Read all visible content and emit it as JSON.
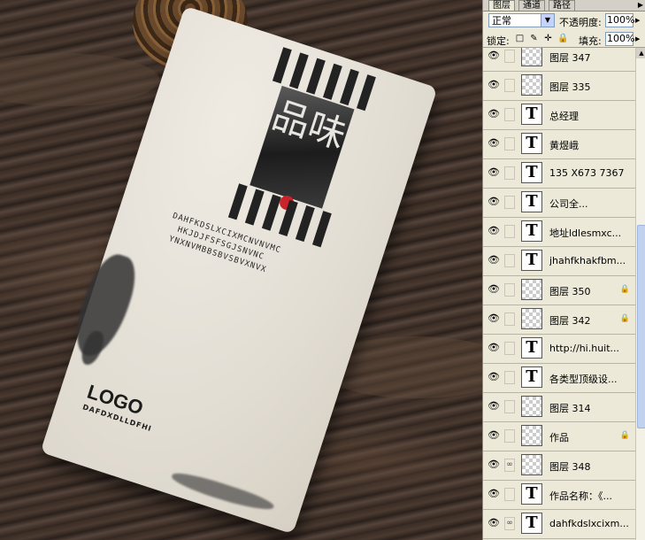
{
  "tabs": [
    {
      "label": "图层"
    },
    {
      "label": "通道"
    },
    {
      "label": "路径"
    }
  ],
  "blend": {
    "mode": "正常",
    "opacity_label": "不透明度:",
    "opacity_value": "100%"
  },
  "lock": {
    "label": "锁定:",
    "fill_label": "填充:",
    "fill_value": "100%"
  },
  "layers": [
    {
      "name": "图层 347",
      "type": "raster"
    },
    {
      "name": "图层 335",
      "type": "raster"
    },
    {
      "name": "总经理",
      "type": "text"
    },
    {
      "name": "黄煜峨",
      "type": "text"
    },
    {
      "name": "135 X673 7367",
      "type": "text"
    },
    {
      "name": "公司全...",
      "type": "text"
    },
    {
      "name": "地址ldlesmxc...",
      "type": "text"
    },
    {
      "name": "jhahfkhakfbm...",
      "type": "text"
    },
    {
      "name": "图层 350",
      "type": "raster",
      "locked": true
    },
    {
      "name": "图层 342",
      "type": "raster",
      "locked": true
    },
    {
      "name": "http://hi.huit...",
      "type": "text"
    },
    {
      "name": "各类型顶级设...",
      "type": "text"
    },
    {
      "name": "图层 314",
      "type": "raster"
    },
    {
      "name": "作品",
      "type": "raster",
      "locked": true
    },
    {
      "name": "图层 348",
      "type": "raster",
      "linked": true
    },
    {
      "name": "作品名称：《...",
      "type": "text"
    },
    {
      "name": "dahfkdslxcixm...",
      "type": "text",
      "linked": true
    }
  ],
  "card": {
    "seal_chars": "品味",
    "lines": [
      "DAHFKDSLXCIXMCNVNVMC",
      "HKJDJFSFSGJSNVNC",
      "YNXNVMBBSBVSBVXNVX"
    ],
    "logo": "LOGO",
    "logo_sub": "DAFDXDLLDFHI"
  }
}
